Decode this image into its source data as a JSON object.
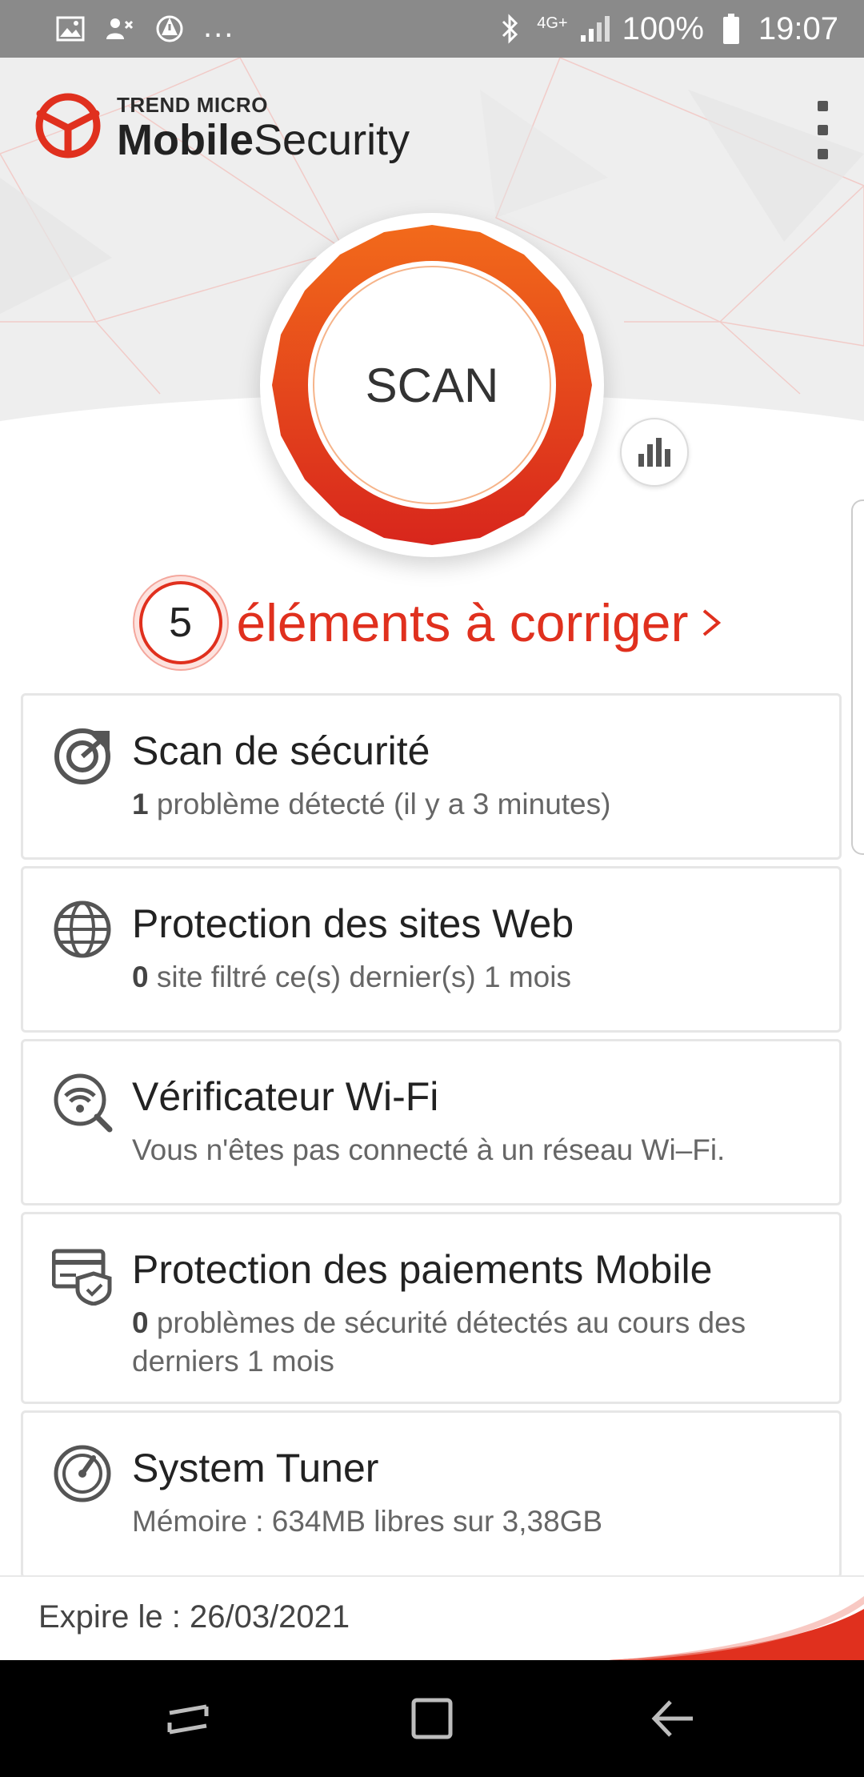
{
  "status_bar": {
    "battery_percent": "100%",
    "time": "19:07",
    "network": "4G+",
    "more": "..."
  },
  "header": {
    "brand_top": "TREND MICRO",
    "brand_bold": "Mobile",
    "brand_regular": "Security"
  },
  "scan": {
    "label": "SCAN"
  },
  "issues": {
    "count": "5",
    "label": "éléments à corriger"
  },
  "cards": [
    {
      "title": "Scan de sécurité",
      "value": "1",
      "subtitle": " problème détecté (il y a 3 minutes)"
    },
    {
      "title": "Protection des sites Web",
      "value": "0",
      "subtitle": " site filtré ce(s) dernier(s) 1 mois"
    },
    {
      "title": "Vérificateur Wi-Fi",
      "value": "",
      "subtitle": "Vous n'êtes pas connecté à un réseau Wi–Fi."
    },
    {
      "title": "Protection des paiements Mobile",
      "value": "0",
      "subtitle": " problèmes de sécurité détectés au cours des derniers 1 mois"
    },
    {
      "title": "System Tuner",
      "value": "",
      "subtitle": "Mémoire : 634MB libres sur 3,38GB"
    }
  ],
  "footer": {
    "expiry": "Expire le : 26/03/2021"
  },
  "colors": {
    "accent": "#e0301e",
    "ring_orange": "#f26a1b",
    "ring_red": "#d8261c"
  }
}
